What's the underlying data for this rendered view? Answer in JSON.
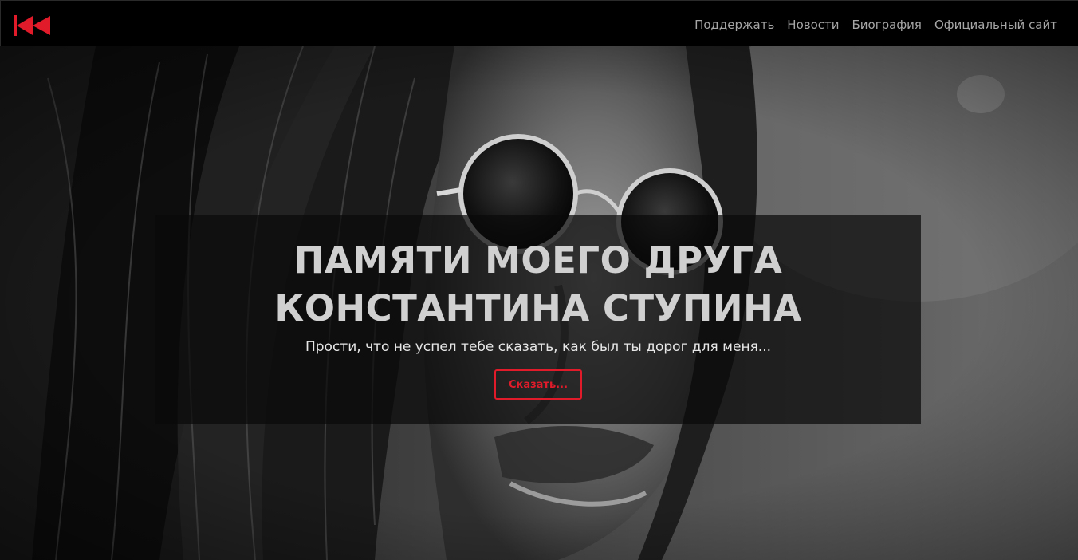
{
  "brand": {
    "logo_icon": "double-rewind-icon",
    "logo_color": "#e11b2a"
  },
  "nav": {
    "items": [
      {
        "label": "Поддержать"
      },
      {
        "label": "Новости"
      },
      {
        "label": "Биография"
      },
      {
        "label": "Официальный сайт"
      }
    ]
  },
  "hero": {
    "background_image": "black-and-white-portrait-photo",
    "title_line1": "ПАМЯТИ МОЕГО ДРУГА",
    "title_line2": "КОНСТАНТИНА СТУПИНА",
    "subtitle": "Прости, что не успел тебе сказать, как был ты дорог для меня...",
    "cta_label": "Сказать..."
  },
  "colors": {
    "accent": "#e11b2a",
    "navbar_bg": "#000000",
    "nav_text": "#a6a6a6",
    "title_text": "#d0d0d0"
  }
}
